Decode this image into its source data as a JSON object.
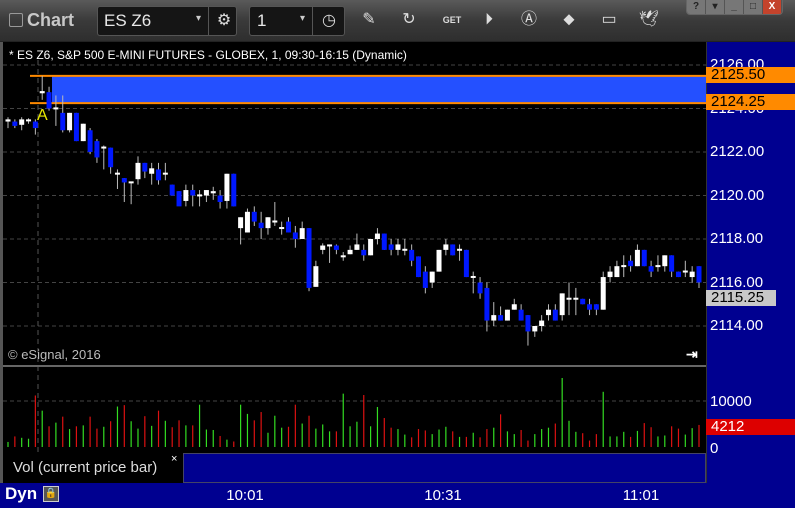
{
  "window": {
    "title": "Chart",
    "buttons": [
      "?",
      "▾",
      "_",
      "□",
      "X"
    ]
  },
  "toolbar": {
    "symbol": "ES Z6",
    "interval": "1",
    "icons": [
      "pencil-icon",
      "refresh-chart-icon",
      "get-data-icon",
      "play-icon",
      "alert-icon",
      "link-icon",
      "comment-icon",
      "twitter-icon"
    ]
  },
  "chart": {
    "legend": "* ES Z6, S&P 500 E-MINI FUTURES - GLOBEX, 1, 09:30-16:15 (Dynamic)",
    "copyright": "© eSignal, 2016",
    "price_labels": [
      "2126.00",
      "2124.00",
      "2122.00",
      "2120.00",
      "2118.00",
      "2116.00",
      "2114.00"
    ],
    "price_levels": [
      2126,
      2124,
      2122,
      2120,
      2118,
      2116,
      2114
    ],
    "upper_line": {
      "value": 2125.5,
      "label": "2125.50"
    },
    "lower_line": {
      "value": 2124.25,
      "label": "2124.25"
    },
    "last_price": {
      "value": 2115.25,
      "label": "2115.25"
    },
    "marker": "A",
    "colors": {
      "up": "#ffffff",
      "down": "#0018ff",
      "zone": "#2450ff",
      "line": "#ff8a00",
      "axis": "#000090",
      "vol_up": "#33dd22",
      "vol_down": "#dd1111"
    },
    "ohlc": [
      [
        2123.4,
        2123.6,
        2123.1,
        2123.5
      ],
      [
        2123.4,
        2123.5,
        2123.1,
        2123.2
      ],
      [
        2123.25,
        2123.6,
        2123.0,
        2123.5
      ],
      [
        2123.5,
        2123.55,
        2123.3,
        2123.5
      ],
      [
        2123.4,
        2123.5,
        2122.8,
        2123.1
      ],
      [
        2124.7,
        2125.5,
        2124.4,
        2124.8
      ],
      [
        2124.75,
        2125.0,
        2123.9,
        2124.0
      ],
      [
        2124.0,
        2124.6,
        2123.2,
        2124.05
      ],
      [
        2123.8,
        2124.6,
        2122.9,
        2123.0
      ],
      [
        2123.0,
        2123.8,
        2122.9,
        2123.8
      ],
      [
        2123.8,
        2123.8,
        2122.5,
        2122.5
      ],
      [
        2122.5,
        2123.3,
        2122.5,
        2123.3
      ],
      [
        2123.0,
        2123.1,
        2121.9,
        2122.0
      ],
      [
        2122.5,
        2122.6,
        2121.5,
        2121.75
      ],
      [
        2122.2,
        2122.3,
        2121.2,
        2122.25
      ],
      [
        2122.2,
        2122.2,
        2121.0,
        2121.3
      ],
      [
        2121.0,
        2121.2,
        2120.3,
        2121.05
      ],
      [
        2120.8,
        2120.8,
        2119.7,
        2120.6
      ],
      [
        2120.6,
        2120.6,
        2119.6,
        2120.65
      ],
      [
        2120.75,
        2121.8,
        2120.5,
        2121.5
      ],
      [
        2121.5,
        2121.5,
        2120.8,
        2121.1
      ],
      [
        2121.0,
        2121.5,
        2120.5,
        2121.25
      ],
      [
        2121.2,
        2121.5,
        2120.5,
        2120.7
      ],
      [
        2121.0,
        2121.5,
        2120.7,
        2121.05
      ],
      [
        2120.5,
        2120.5,
        2120.0,
        2120.0
      ],
      [
        2120.2,
        2120.2,
        2119.6,
        2119.5
      ],
      [
        2119.75,
        2120.5,
        2119.5,
        2120.25
      ],
      [
        2120.25,
        2120.5,
        2119.5,
        2120.0
      ],
      [
        2120.0,
        2120.25,
        2119.5,
        2120.05
      ],
      [
        2120.0,
        2120.25,
        2119.7,
        2120.25
      ],
      [
        2120.1,
        2120.4,
        2119.8,
        2120.2
      ],
      [
        2120.0,
        2120.25,
        2119.4,
        2119.7
      ],
      [
        2119.75,
        2121.0,
        2119.4,
        2121.0
      ],
      [
        2121.0,
        2121.0,
        2119.5,
        2119.5
      ],
      [
        2118.5,
        2119.0,
        2117.75,
        2119.0
      ],
      [
        2118.3,
        2119.4,
        2118.3,
        2119.25
      ],
      [
        2119.25,
        2119.5,
        2118.6,
        2118.8
      ],
      [
        2118.75,
        2119.25,
        2118.0,
        2118.5
      ],
      [
        2118.5,
        2119.0,
        2118.2,
        2119.0
      ],
      [
        2118.8,
        2119.7,
        2118.6,
        2118.85
      ],
      [
        2118.5,
        2118.8,
        2118.2,
        2118.55
      ],
      [
        2118.8,
        2119.0,
        2118.3,
        2118.3
      ],
      [
        2118.3,
        2118.6,
        2117.6,
        2118.0
      ],
      [
        2118.0,
        2118.8,
        2118.0,
        2118.5
      ],
      [
        2118.5,
        2118.5,
        2115.6,
        2115.75
      ],
      [
        2115.8,
        2117.0,
        2115.8,
        2116.75
      ],
      [
        2117.5,
        2117.8,
        2117.3,
        2117.7
      ],
      [
        2117.7,
        2117.75,
        2116.9,
        2117.75
      ],
      [
        2117.7,
        2117.75,
        2117.3,
        2117.5
      ],
      [
        2117.2,
        2117.4,
        2117.0,
        2117.25
      ],
      [
        2117.3,
        2117.7,
        2117.3,
        2117.5
      ],
      [
        2117.5,
        2118.25,
        2117.5,
        2117.75
      ],
      [
        2117.5,
        2117.75,
        2117.0,
        2117.25
      ],
      [
        2117.25,
        2118.0,
        2117.25,
        2118.0
      ],
      [
        2118.0,
        2118.5,
        2117.75,
        2118.25
      ],
      [
        2118.25,
        2118.25,
        2117.5,
        2117.5
      ],
      [
        2117.75,
        2118.0,
        2117.25,
        2117.5
      ],
      [
        2117.5,
        2118.0,
        2117.25,
        2117.75
      ],
      [
        2117.5,
        2118.0,
        2117.25,
        2117.55
      ],
      [
        2117.5,
        2117.75,
        2116.75,
        2117.0
      ],
      [
        2117.2,
        2117.2,
        2116.25,
        2116.25
      ],
      [
        2116.5,
        2116.75,
        2115.5,
        2115.75
      ],
      [
        2116.0,
        2116.5,
        2115.75,
        2116.5
      ],
      [
        2116.5,
        2117.5,
        2116.5,
        2117.5
      ],
      [
        2117.5,
        2118.0,
        2117.25,
        2117.75
      ],
      [
        2117.75,
        2117.75,
        2117.25,
        2117.25
      ],
      [
        2117.5,
        2117.75,
        2117.0,
        2117.55
      ],
      [
        2117.5,
        2117.5,
        2116.25,
        2116.25
      ],
      [
        2116.25,
        2116.5,
        2115.5,
        2116.3
      ],
      [
        2116.0,
        2116.25,
        2115.25,
        2115.5
      ],
      [
        2115.75,
        2116.0,
        2113.75,
        2114.25
      ],
      [
        2114.25,
        2115.1,
        2114.0,
        2114.5
      ],
      [
        2114.5,
        2114.9,
        2114.25,
        2114.25
      ],
      [
        2114.25,
        2114.75,
        2114.25,
        2114.75
      ],
      [
        2114.75,
        2115.25,
        2114.75,
        2115.0
      ],
      [
        2114.75,
        2115.0,
        2114.25,
        2114.25
      ],
      [
        2114.5,
        2114.5,
        2113.1,
        2113.75
      ],
      [
        2113.75,
        2114.0,
        2113.5,
        2114.0
      ],
      [
        2114.0,
        2114.5,
        2113.75,
        2114.25
      ],
      [
        2114.5,
        2115.0,
        2114.25,
        2114.75
      ],
      [
        2114.75,
        2115.0,
        2114.25,
        2114.25
      ],
      [
        2114.5,
        2115.5,
        2114.25,
        2115.5
      ],
      [
        2115.25,
        2116.0,
        2114.5,
        2115.3
      ],
      [
        2115.25,
        2115.75,
        2114.5,
        2115.3
      ],
      [
        2115.25,
        2115.25,
        2115.0,
        2115.0
      ],
      [
        2115.0,
        2115.25,
        2114.5,
        2114.75
      ],
      [
        2115.0,
        2115.0,
        2114.5,
        2114.75
      ],
      [
        2114.75,
        2116.5,
        2114.75,
        2116.25
      ],
      [
        2116.25,
        2116.75,
        2116.0,
        2116.5
      ],
      [
        2116.25,
        2117.0,
        2116.25,
        2116.75
      ],
      [
        2116.75,
        2117.25,
        2116.25,
        2116.8
      ],
      [
        2117.0,
        2117.25,
        2116.5,
        2116.75
      ],
      [
        2116.75,
        2117.75,
        2116.75,
        2117.5
      ],
      [
        2117.5,
        2117.5,
        2116.75,
        2116.75
      ],
      [
        2116.75,
        2117.0,
        2116.25,
        2116.5
      ],
      [
        2116.75,
        2117.25,
        2116.5,
        2116.8
      ],
      [
        2116.75,
        2117.25,
        2116.5,
        2117.25
      ],
      [
        2117.25,
        2117.25,
        2116.25,
        2116.5
      ],
      [
        2116.5,
        2116.5,
        2116.25,
        2116.25
      ],
      [
        2116.5,
        2117.0,
        2116.25,
        2116.55
      ],
      [
        2116.25,
        2116.75,
        2116.0,
        2116.5
      ],
      [
        2116.75,
        2116.75,
        2115.75,
        2116.0
      ]
    ],
    "volume": {
      "title": "Vol (current price bar)",
      "labels": [
        "10000",
        "0"
      ],
      "levels": [
        10000,
        0
      ],
      "last": "4212",
      "values": [
        1100,
        2300,
        2000,
        1800,
        11200,
        7900,
        4500,
        5300,
        6600,
        3900,
        4500,
        4700,
        6600,
        4000,
        4400,
        5600,
        8800,
        9100,
        5600,
        4000,
        6700,
        4600,
        7900,
        5700,
        4300,
        5800,
        4700,
        4700,
        9200,
        3800,
        3700,
        2400,
        1600,
        1200,
        9200,
        7200,
        5800,
        7600,
        3100,
        6800,
        4200,
        4400,
        9200,
        5100,
        6800,
        4000,
        4900,
        3400,
        3400,
        11600,
        4500,
        5500,
        11300,
        4500,
        8700,
        6300,
        4200,
        3900,
        2700,
        2100,
        3900,
        3600,
        2800,
        3800,
        4400,
        3400,
        2200,
        2200,
        3100,
        2100,
        3900,
        4200,
        7100,
        3400,
        2800,
        3700,
        1400,
        2800,
        3900,
        4200,
        5100,
        15000,
        5700,
        3300,
        3000,
        1400,
        2800,
        12000,
        2300,
        2300,
        3300,
        2200,
        3500,
        5200,
        4300,
        2300,
        2500,
        4500,
        4000,
        2700,
        4100,
        4800
      ]
    },
    "time_labels": [
      "10:01",
      "10:31",
      "11:01"
    ],
    "mode": "Dyn"
  }
}
